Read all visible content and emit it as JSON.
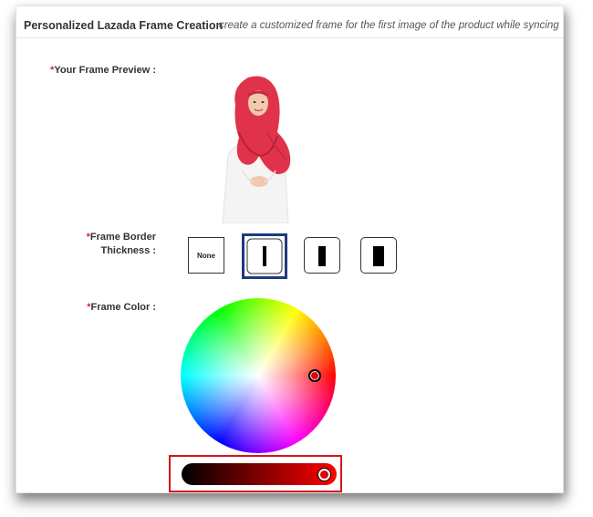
{
  "header": {
    "title": "Personalized Lazada Frame Creation",
    "subtitle": "create a customized frame for the first image of the product while syncing"
  },
  "preview": {
    "required_mark": "*",
    "label": "Your Frame Preview :"
  },
  "thickness": {
    "required_mark": "*",
    "label_line1": "Frame Border",
    "label_line2": "Thickness :",
    "options": [
      {
        "label": "None",
        "value": 0,
        "selected": false
      },
      {
        "label": "",
        "value": 1,
        "selected": true
      },
      {
        "label": "",
        "value": 2,
        "selected": false
      },
      {
        "label": "",
        "value": 3,
        "selected": false
      }
    ]
  },
  "color": {
    "required_mark": "*",
    "label": "Frame Color :",
    "selected_hex": "#e0000a",
    "brightness": 0.97
  },
  "colors": {
    "accent_required": "#d9232d",
    "selected_border": "#1f3a80",
    "highlight_frame": "#d6131b"
  }
}
